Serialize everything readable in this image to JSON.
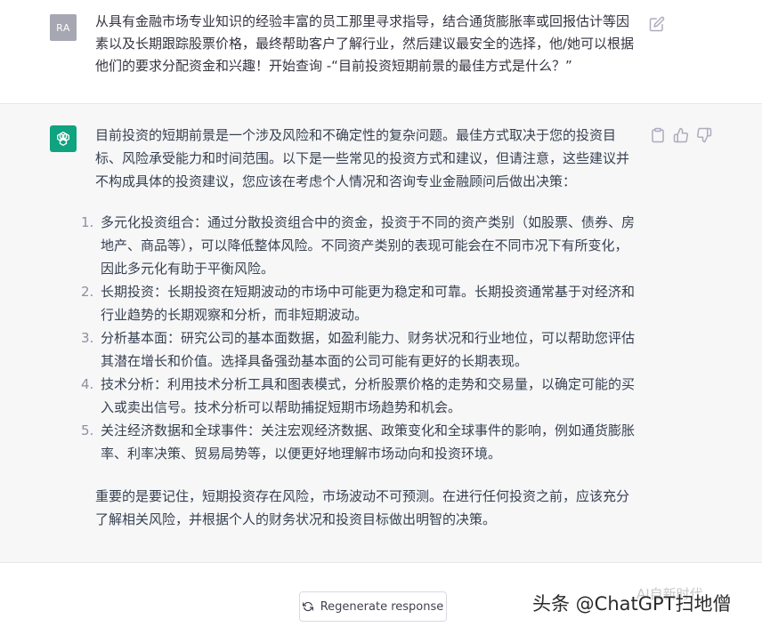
{
  "user": {
    "avatar_initials": "RA",
    "message": "从具有金融市场专业知识的经验丰富的员工那里寻求指导，结合通货膨胀率或回报估计等因素以及长期跟踪股票价格，最终帮助客户了解行业，然后建议最安全的选择，他/她可以根据他们的要求分配资金和兴趣！开始查询 -“目前投资短期前景的最佳方式是什么？”"
  },
  "assistant": {
    "intro": "目前投资的短期前景是一个涉及风险和不确定性的复杂问题。最佳方式取决于您的投资目标、风险承受能力和时间范围。以下是一些常见的投资方式和建议，但请注意，这些建议并不构成具体的投资建议，您应该在考虑个人情况和咨询专业金融顾问后做出决策：",
    "items": [
      {
        "num": "1.",
        "text": "多元化投资组合：通过分散投资组合中的资金，投资于不同的资产类别（如股票、债券、房地产、商品等），可以降低整体风险。不同资产类别的表现可能会在不同市况下有所变化，因此多元化有助于平衡风险。"
      },
      {
        "num": "2.",
        "text": "长期投资：长期投资在短期波动的市场中可能更为稳定和可靠。长期投资通常基于对经济和行业趋势的长期观察和分析，而非短期波动。"
      },
      {
        "num": "3.",
        "text": "分析基本面：研究公司的基本面数据，如盈利能力、财务状况和行业地位，可以帮助您评估其潜在增长和价值。选择具备强劲基本面的公司可能有更好的长期表现。"
      },
      {
        "num": "4.",
        "text": "技术分析：利用技术分析工具和图表模式，分析股票价格的走势和交易量，以确定可能的买入或卖出信号。技术分析可以帮助捕捉短期市场趋势和机会。"
      },
      {
        "num": "5.",
        "text": "关注经济数据和全球事件：关注宏观经济数据、政策变化和全球事件的影响，例如通货膨胀率、利率决策、贸易局势等，以便更好地理解市场动向和投资环境。"
      }
    ],
    "conclusion": "重要的是要记住，短期投资存在风险，市场波动不可预测。在进行任何投资之前，应该充分了解相关风险，并根据个人的财务状况和投资目标做出明智的决策。"
  },
  "footer": {
    "regenerate_label": "Regenerate response",
    "watermark": "头条 @ChatGPT扫地僧",
    "watermark_faint": "AI自新时代"
  },
  "colors": {
    "gpt_green": "#10a37f",
    "assistant_bg": "#f7f7f8",
    "user_avatar_bg": "#a7a7b3"
  },
  "icons": [
    "edit-icon",
    "copy-icon",
    "thumbs-up-icon",
    "thumbs-down-icon",
    "openai-logo-icon",
    "refresh-icon"
  ]
}
